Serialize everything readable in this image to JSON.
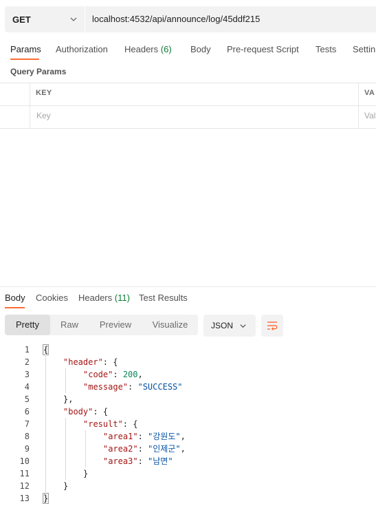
{
  "request": {
    "method": "GET",
    "url": "localhost:4532/api/announce/log/45ddf215"
  },
  "request_tabs": [
    {
      "label": "Params"
    },
    {
      "label": "Authorization"
    },
    {
      "label": "Headers",
      "count": "(6)"
    },
    {
      "label": "Body"
    },
    {
      "label": "Pre-request Script"
    },
    {
      "label": "Tests"
    },
    {
      "label": "Settin"
    }
  ],
  "query_params": {
    "title": "Query Params",
    "col_key": "KEY",
    "col_value": "VA",
    "key_placeholder": "Key",
    "value_placeholder": "Val"
  },
  "response_tabs": [
    {
      "label": "Body"
    },
    {
      "label": "Cookies"
    },
    {
      "label": "Headers",
      "count": "(11)"
    },
    {
      "label": "Test Results"
    }
  ],
  "view_modes": [
    "Pretty",
    "Raw",
    "Preview",
    "Visualize"
  ],
  "active_view": "Pretty",
  "format": "JSON",
  "code": {
    "line_numbers": [
      "1",
      "2",
      "3",
      "4",
      "5",
      "6",
      "7",
      "8",
      "9",
      "10",
      "11",
      "12",
      "13"
    ],
    "open_brace": "{",
    "close_brace": "}",
    "k_header": "\"header\"",
    "k_code": "\"code\"",
    "v_code": "200",
    "k_message": "\"message\"",
    "v_message": "\"SUCCESS\"",
    "k_body": "\"body\"",
    "k_result": "\"result\"",
    "k_area1": "\"area1\"",
    "v_area1": "\"강원도\"",
    "k_area2": "\"area2\"",
    "v_area2": "\"인제군\"",
    "k_area3": "\"area3\"",
    "v_area3": "\"남면\""
  },
  "colors": {
    "accent": "#ff6c37",
    "count": "#0c7b33",
    "json_key": "#a31515",
    "json_string": "#0451a5",
    "json_number": "#098658"
  }
}
